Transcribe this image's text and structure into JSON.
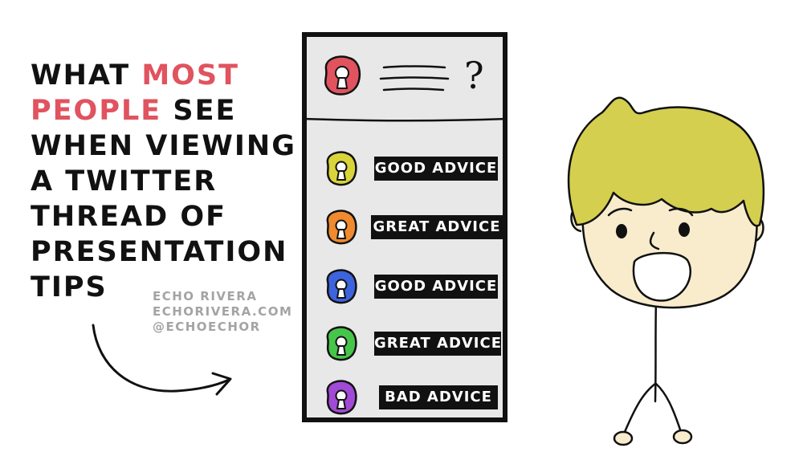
{
  "heading": {
    "line1_pre": "WHAT ",
    "line1_accent": "MOST",
    "line2_accent": "PEOPLE",
    "line2_post": " SEE",
    "line3": "WHEN VIEWING",
    "line4": "A TWITTER",
    "line5": "THREAD OF",
    "line6": "PRESENTATION",
    "line7": "TIPS"
  },
  "credit": {
    "name": "ECHO RIVERA",
    "site": "ECHORIVERA.COM",
    "handle": "@ECHOECHOR"
  },
  "thread": {
    "header_glyph": "?",
    "items": [
      {
        "label": "GOOD ADVICE",
        "color": "#d8d43a"
      },
      {
        "label": "GREAT ADVICE",
        "color": "#ef8a2e"
      },
      {
        "label": "GOOD ADVICE",
        "color": "#3d63dd"
      },
      {
        "label": "GREAT ADVICE",
        "color": "#46c54a"
      },
      {
        "label": "BAD ADVICE",
        "color": "#a14ad6"
      }
    ]
  },
  "colors": {
    "accent": "#e0535f",
    "header_avatar": "#e0535f",
    "hair": "#d4cf4e",
    "skin": "#f8eccd"
  }
}
